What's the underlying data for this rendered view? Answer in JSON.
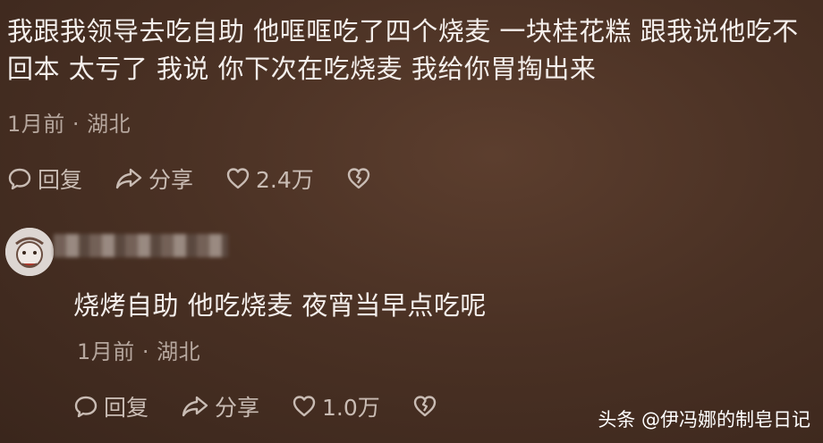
{
  "comments": [
    {
      "text": "我跟我领导去吃自助 他哐哐吃了四个烧麦 一块桂花糕 跟我说他吃不回本 太亏了 我说 你下次在吃烧麦 我给你胃掏出来",
      "meta": "1月前 · 湖北",
      "reply_label": "回复",
      "share_label": "分享",
      "like_count": "2.4万"
    },
    {
      "text": "烧烤自助 他吃烧麦 夜宵当早点吃呢",
      "meta": "1月前 · 湖北",
      "reply_label": "回复",
      "share_label": "分享",
      "like_count": "1.0万"
    }
  ],
  "watermark": "头条 @伊冯娜的制皂日记",
  "icons": {
    "reply": "reply-icon",
    "share": "share-icon",
    "like": "heart-icon",
    "dislike": "broken-heart-icon"
  }
}
